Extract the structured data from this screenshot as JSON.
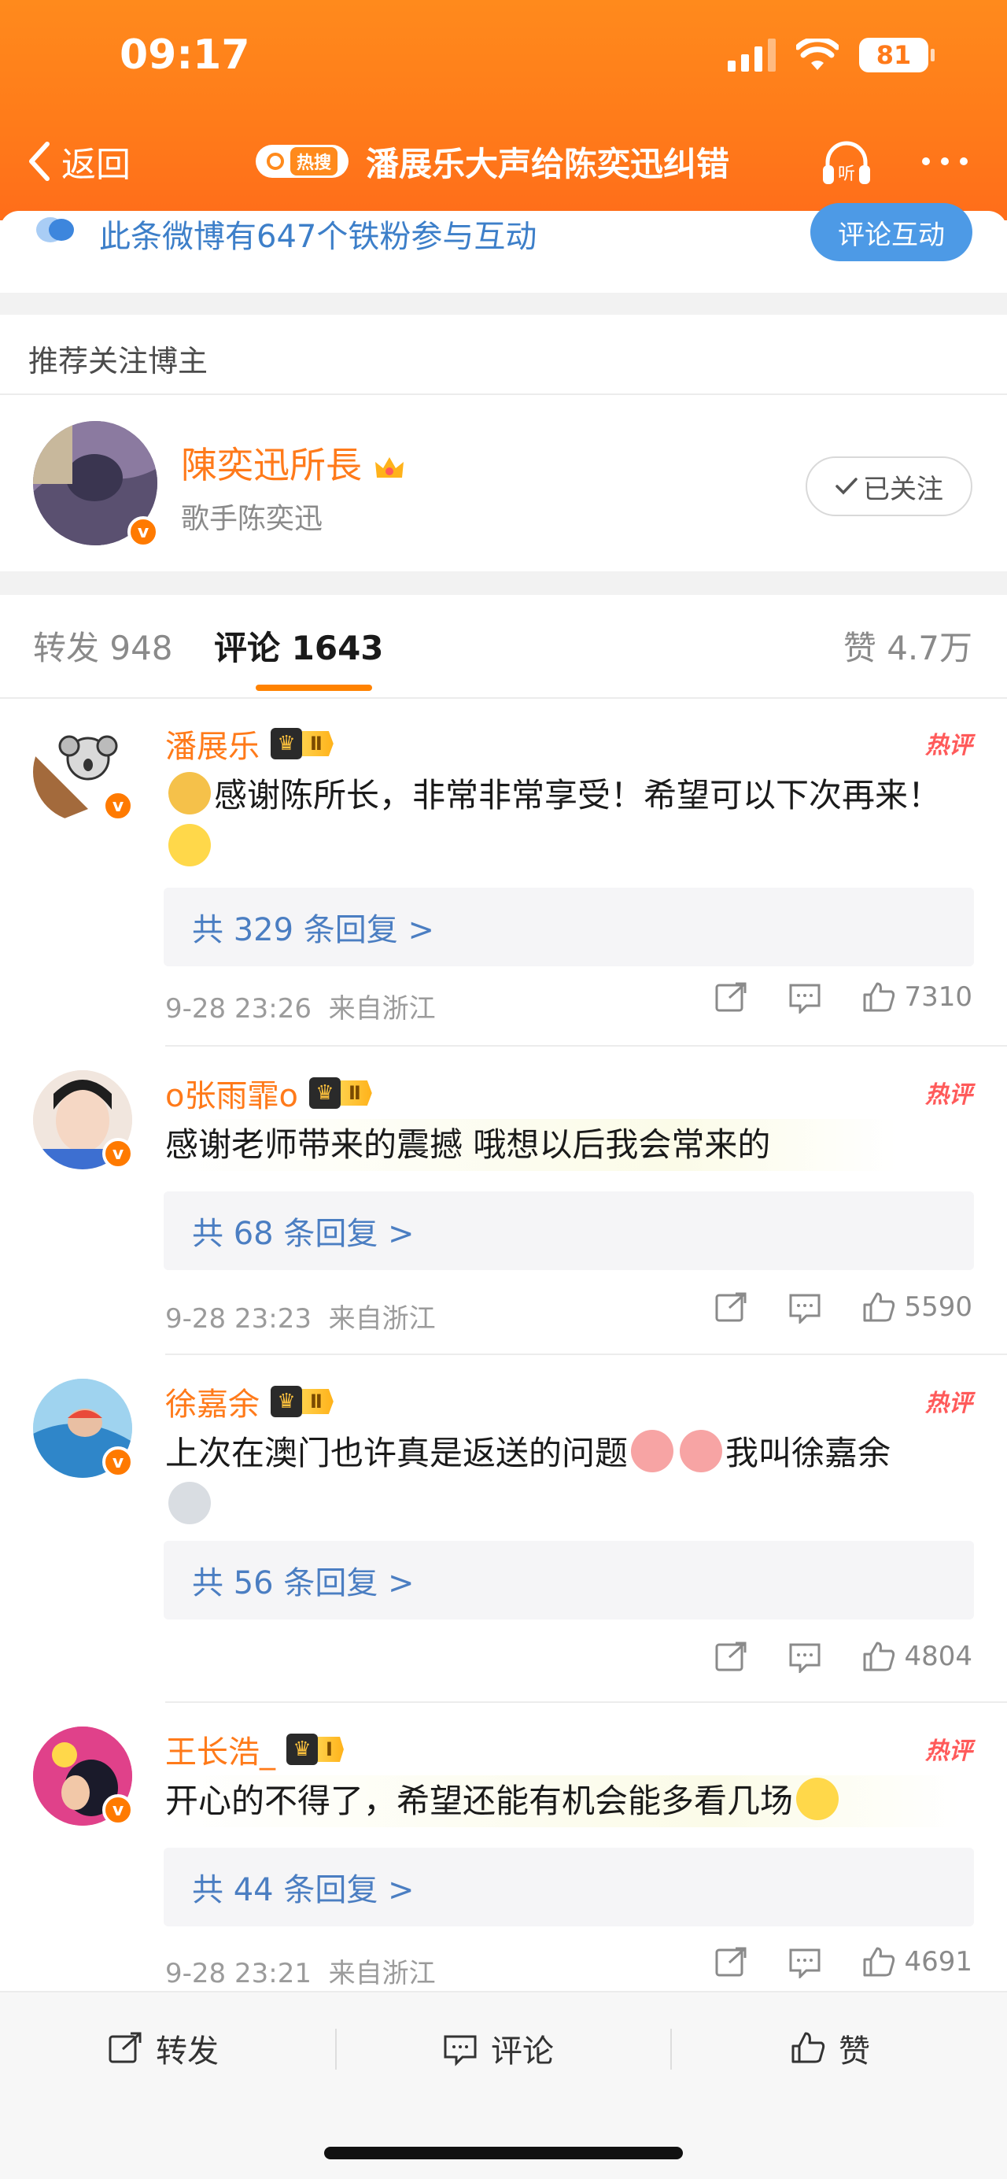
{
  "status_bar": {
    "time": "09:17",
    "battery": "81"
  },
  "nav": {
    "back_label": "返回",
    "hot_tag": "热搜",
    "title": "潘展乐大声给陈奕迅纠错",
    "listen_label": "听"
  },
  "fan_banner": {
    "text": "此条微博有647个铁粉参与互动",
    "button": "评论互动"
  },
  "recommend": {
    "section_title": "推荐关注博主",
    "name": "陳奕迅所長",
    "desc": "歌手陈奕迅",
    "follow_label": "已关注",
    "badge": "v"
  },
  "tabs": [
    {
      "label": "转发 948"
    },
    {
      "label": "评论 1643"
    },
    {
      "label": "赞 4.7万"
    }
  ],
  "comments": [
    {
      "name": "潘展乐",
      "level": "Ⅱ",
      "hot": "热评",
      "text": "感谢陈所长，非常非常享受！希望可以下次再来！",
      "replies": "共 329 条回复 >",
      "time": "9-28 23:26",
      "location": "来自浙江",
      "likes": "7310"
    },
    {
      "name": "o张雨霏o",
      "level": "Ⅱ",
      "hot": "热评",
      "text": "感谢老师带来的震撼 哦想以后我会常来的",
      "replies": "共 68 条回复 >",
      "time": "9-28 23:23",
      "location": "来自浙江",
      "likes": "5590"
    },
    {
      "name": "徐嘉余",
      "level": "Ⅱ",
      "hot": "热评",
      "text_a": "上次在澳门也许真是返送的问题",
      "text_b": "我叫徐嘉余",
      "replies": "共 56 条回复 >",
      "likes": "4804"
    },
    {
      "name": "王长浩_",
      "level": "Ⅰ",
      "hot": "热评",
      "text": "开心的不得了，希望还能有机会能多看几场",
      "replies": "共 44 条回复 >",
      "time": "9-28 23:21",
      "location": "来自浙江",
      "likes": "4691"
    }
  ],
  "bottom_bar": {
    "repost": "转发",
    "comment": "评论",
    "like": "赞"
  },
  "colors": {
    "accent": "#ff7a1a",
    "link": "#4b7ec2",
    "hot": "#ff5a5a"
  }
}
